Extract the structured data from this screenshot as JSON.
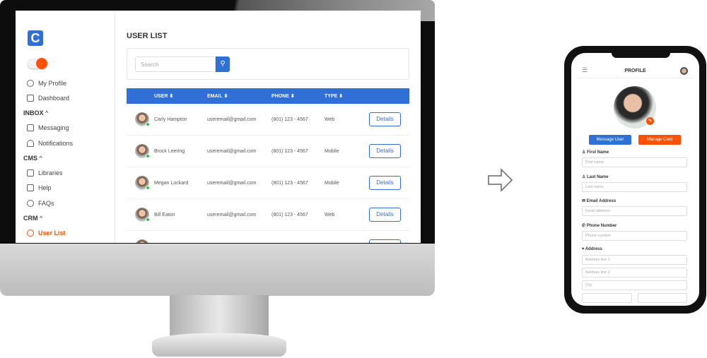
{
  "desktop": {
    "sidebar": {
      "items": [
        {
          "label": "My Profile",
          "icon": "user-icon"
        },
        {
          "label": "Dashboard",
          "icon": "grid-icon"
        },
        {
          "section": "INBOX"
        },
        {
          "label": "Messaging",
          "icon": "message-icon"
        },
        {
          "label": "Notifications",
          "icon": "bell-icon"
        },
        {
          "section": "CMS"
        },
        {
          "label": "Libraries",
          "icon": "library-icon"
        },
        {
          "label": "Help",
          "icon": "info-icon"
        },
        {
          "label": "FAQs",
          "icon": "question-icon"
        },
        {
          "section": "CRM"
        },
        {
          "label": "User List",
          "icon": "users-icon",
          "active": true
        }
      ],
      "chevron": "^"
    },
    "title": "USER LIST",
    "search": {
      "placeholder": "Search",
      "icon": "⚲"
    },
    "table": {
      "headers": [
        "USER ⬍",
        "EMAIL ⬍",
        "PHONE ⬍",
        "TYPE ⬍"
      ],
      "rows": [
        {
          "name": "Carly Hampton",
          "email": "useremail@gmail.com",
          "phone": "(801) 123 - 4567",
          "type": "Web",
          "action": "Details"
        },
        {
          "name": "Brock Leering",
          "email": "useremail@gmail.com",
          "phone": "(801) 123 - 4567",
          "type": "Mobile",
          "action": "Details"
        },
        {
          "name": "Megan Lockard",
          "email": "useremail@gmail.com",
          "phone": "(801) 123 - 4567",
          "type": "Mobile",
          "action": "Details"
        },
        {
          "name": "Bill Eaton",
          "email": "useremail@gmail.com",
          "phone": "(801) 123 - 4567",
          "type": "Web",
          "action": "Details"
        }
      ]
    },
    "colors": {
      "accent": "#2f6fd6",
      "brand": "#fd5108",
      "online": "#2ec24a"
    }
  },
  "mobile": {
    "title": "PROFILE",
    "menu_icon": "☰",
    "edit_icon": "✎",
    "message_button": "Message User",
    "manage_button": "Manage Card",
    "fields": [
      {
        "label": "First Name",
        "placeholder": "First name",
        "icon": "user-icon"
      },
      {
        "label": "Last Name",
        "placeholder": "Last name",
        "icon": "user-icon"
      },
      {
        "label": "Email Address",
        "placeholder": "Email address",
        "icon": "mail-icon"
      },
      {
        "label": "Phone Number",
        "placeholder": "Phone number",
        "icon": "phone-icon"
      }
    ],
    "address": {
      "label": "Address",
      "lines": [
        "Address line 1",
        "Address line 2",
        "City"
      ]
    }
  }
}
